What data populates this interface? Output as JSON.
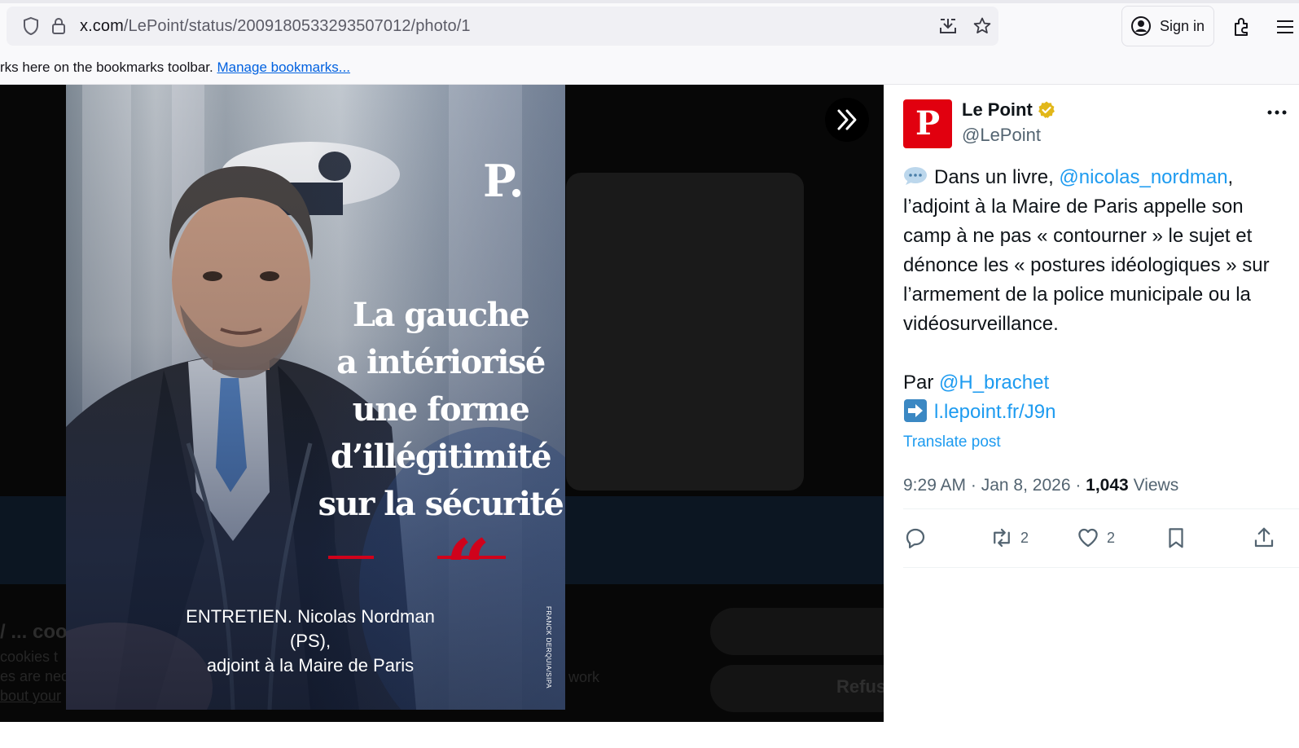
{
  "browser": {
    "url_host": "x.com",
    "url_path": "/LePoint/status/2009180533293507012/photo/1",
    "sign_in_label": "Sign in"
  },
  "bookmarks_bar": {
    "message": "rks here on the bookmarks toolbar.",
    "manage_link": "Manage bookmarks..."
  },
  "photo": {
    "logo": "P.",
    "headline_lines": [
      "La gauche",
      "a intériorisé",
      "une forme",
      "d’illégitimité",
      "sur la sécurité"
    ],
    "quote_mark": "“",
    "caption_lines": [
      "ENTRETIEN. Nicolas Nordman (PS),",
      "adjoint à la Maire de Paris"
    ],
    "credit": "FRANCK DERQUIA/SIPA"
  },
  "cookie_overlay": {
    "title": "/ ... coo",
    "lines": [
      "cookies t",
      "es are nec",
      "bout your"
    ],
    "work": "work",
    "refuse": "Refus"
  },
  "tweet": {
    "avatar_letter": "P",
    "display_name": "Le Point",
    "handle": "@LePoint",
    "text_intro": "Dans un livre, ",
    "mention_1": "@nicolas_nordman",
    "text_body": ", l’adjoint à la Maire de Paris appelle son camp à ne pas « contourner » le sujet et dénonce les « postures idéologiques » sur l’armement de la police municipale ou la vidéosurveillance.",
    "par_label": "Par ",
    "mention_2": "@H_brachet",
    "link": "l.lepoint.fr/J9n",
    "translate_label": "Translate post",
    "time": "9:29 AM",
    "date": "Jan 8, 2026",
    "views_count": "1,043",
    "views_label": "Views",
    "retweets": "2",
    "likes": "2"
  },
  "colors": {
    "accent": "#1d9bf0",
    "brand_red": "#e1000f",
    "quote_red": "#d0021b",
    "verified_gold": "#e2b719"
  }
}
